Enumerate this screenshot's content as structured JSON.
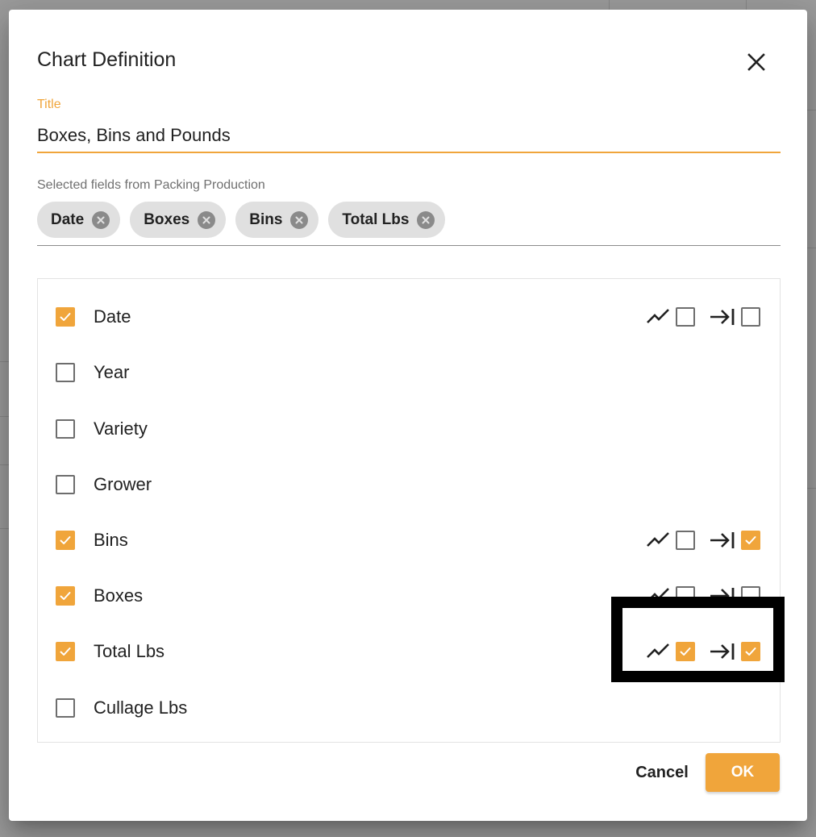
{
  "dialog": {
    "title": "Chart Definition",
    "title_field": {
      "label": "Title",
      "value": "Boxes, Bins and Pounds"
    },
    "selected_fields_label": "Selected fields from Packing Production",
    "chips": [
      {
        "label": "Date"
      },
      {
        "label": "Boxes"
      },
      {
        "label": "Bins"
      },
      {
        "label": "Total Lbs"
      }
    ],
    "fields": [
      {
        "label": "Date",
        "checked": true,
        "options": {
          "line": false,
          "axis": false
        }
      },
      {
        "label": "Year",
        "checked": false,
        "options": null
      },
      {
        "label": "Variety",
        "checked": false,
        "options": null
      },
      {
        "label": "Grower",
        "checked": false,
        "options": null
      },
      {
        "label": "Bins",
        "checked": true,
        "options": {
          "line": false,
          "axis": true
        }
      },
      {
        "label": "Boxes",
        "checked": true,
        "options": {
          "line": false,
          "axis": false
        }
      },
      {
        "label": "Total Lbs",
        "checked": true,
        "options": {
          "line": true,
          "axis": true
        }
      },
      {
        "label": "Cullage Lbs",
        "checked": false,
        "options": null
      }
    ],
    "buttons": {
      "cancel": "Cancel",
      "ok": "OK"
    }
  },
  "icons": {
    "close": "close-icon",
    "chip_remove": "cancel-circle-icon",
    "line_chart": "show-chart-icon",
    "axis": "last-page-arrow-icon"
  },
  "colors": {
    "accent": "#f0a53b",
    "chip_bg": "#e0e0e0",
    "text": "#212121"
  }
}
